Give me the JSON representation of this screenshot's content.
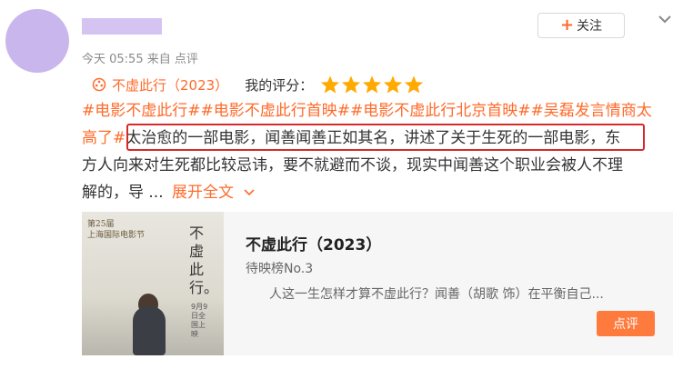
{
  "user": {
    "name": "",
    "time": "今天 05:55",
    "source": "来自 点评"
  },
  "actions": {
    "follow_label": "关注",
    "follow_icon": "plus-icon",
    "collapse_icon": "chevron-down-icon"
  },
  "movie_ref": {
    "title": "不虚此行（2023）",
    "icon": "film-icon"
  },
  "rating": {
    "label": "我的评分：",
    "stars": 5,
    "max_stars": 5,
    "color": "#ffaa00"
  },
  "review": {
    "line1": "#电影不虚此行##电影不虚此行首映##电影不虚此行北京首映##吴磊发言情商太",
    "line2_tag": "高了#",
    "line2_text": "太治愈的一部电影，闻善闻善正如其名，讲述了关于生死的一部电影，",
    "line2_tail": "东",
    "line3": "方人向来对生死都比较忌讳，要不就避而不谈，现实中闻善这个职业会被人不理",
    "line4": "解的，导 ...",
    "expand_label": "展开全文"
  },
  "card": {
    "poster_fest_line1": "第25届",
    "poster_fest_line2": "上海国际电影节",
    "poster_title": "不虛此行。",
    "poster_date": "9月9日全国上映",
    "title": "不虚此行（2023）",
    "rank": "待映榜No.3",
    "desc": "人这一生怎样才算不虚此行？闻善（胡歌 饰）在平衡自己...",
    "review_label": "点评"
  },
  "colors": {
    "accent": "#ff6a2a",
    "highlight_border": "#d62a2a"
  }
}
